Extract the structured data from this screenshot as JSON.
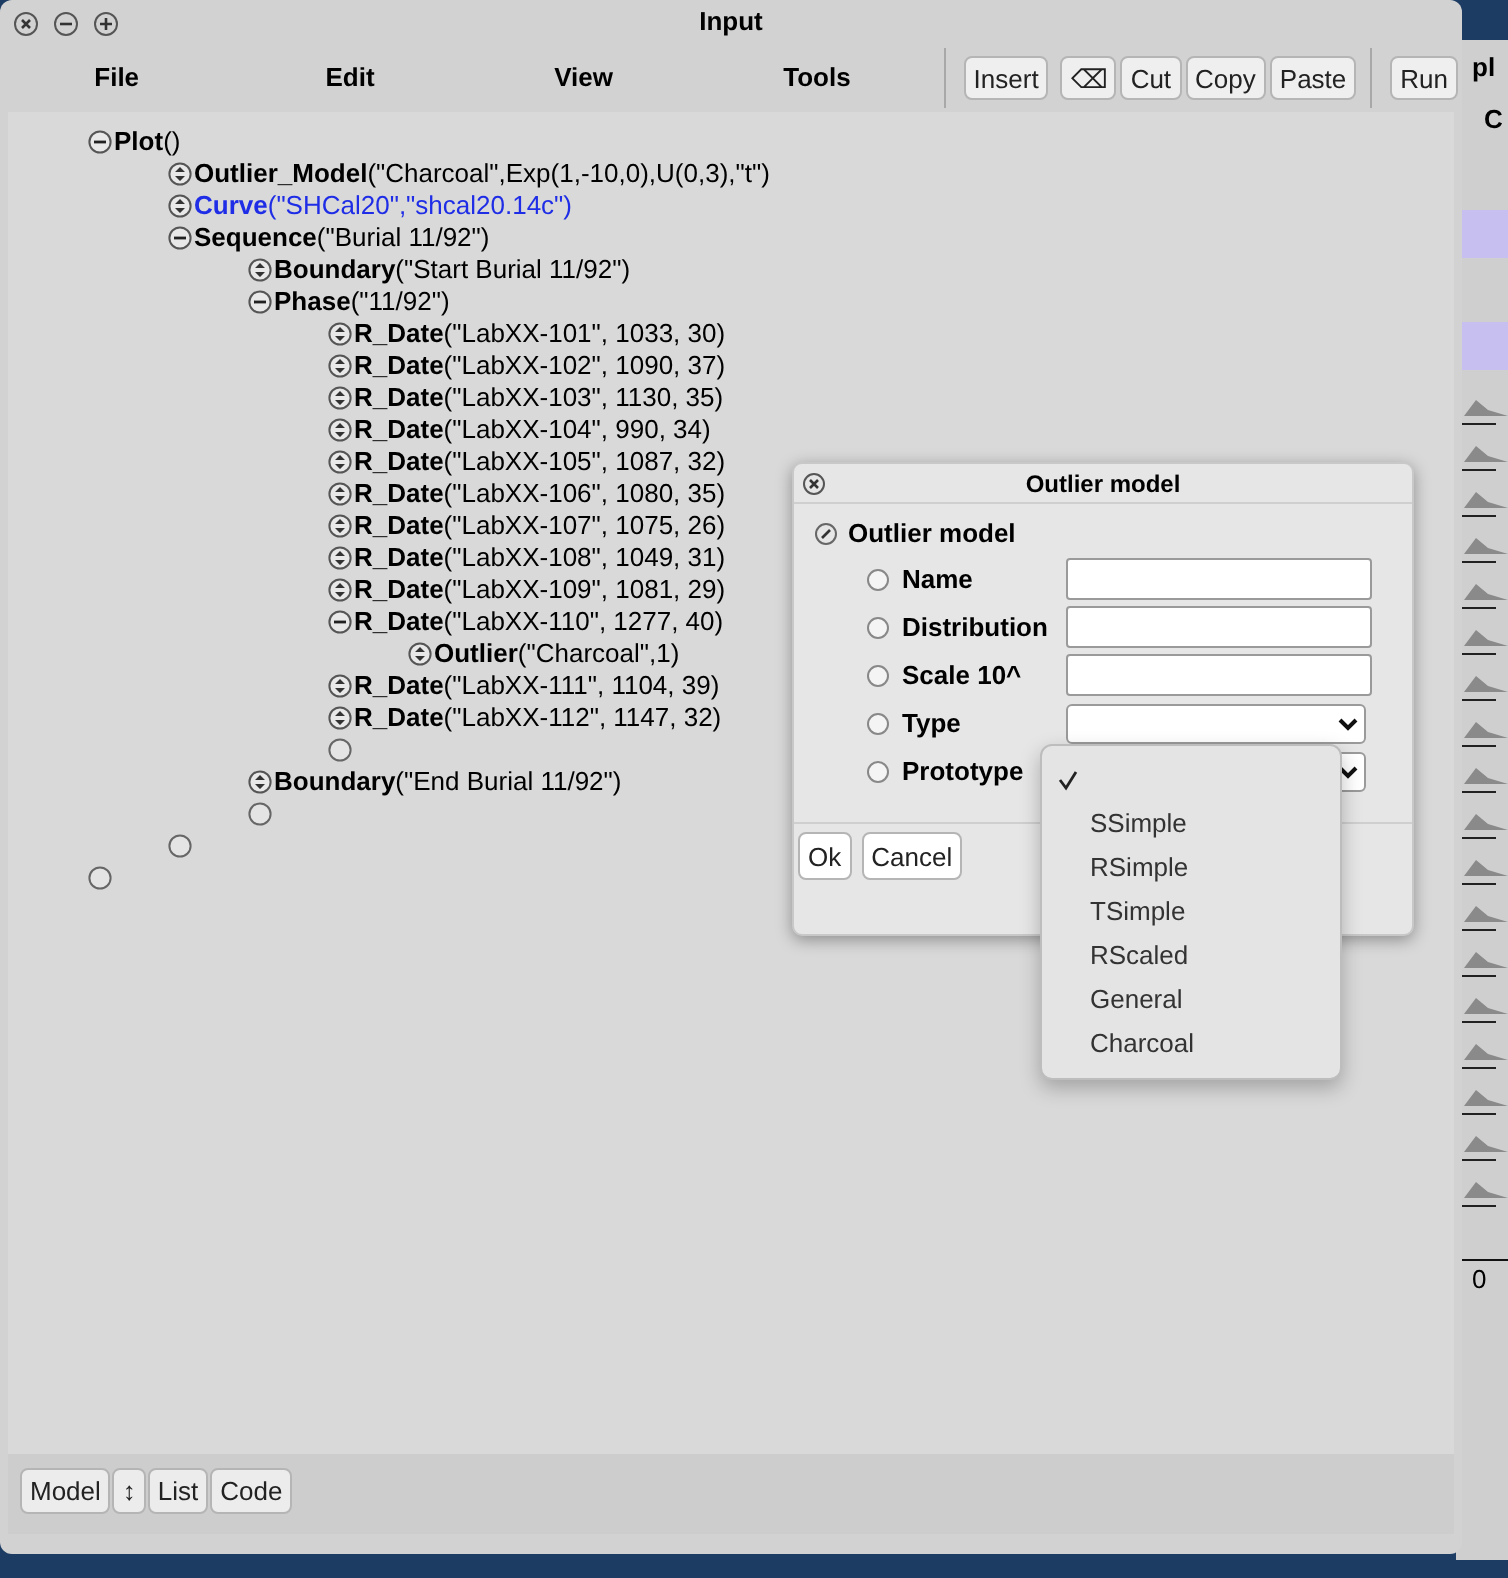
{
  "window": {
    "title": "Input"
  },
  "menu": [
    "File",
    "Edit",
    "View",
    "Tools"
  ],
  "toolbar": [
    [
      "Insert"
    ],
    [
      "⌫",
      "Cut",
      "Copy",
      "Paste"
    ],
    [
      "Run"
    ]
  ],
  "tree": [
    {
      "kind": "node",
      "expanded": true,
      "text": "**Plot**()",
      "highlighted": false,
      "children": [
        {
          "kind": "node",
          "expanded": false,
          "text": "**Outlier_Model**(\"Charcoal\",Exp(1,-10,0),U(0,3),\"t\")",
          "highlighted": false
        },
        {
          "kind": "node",
          "expanded": false,
          "text": "**Curve**(\"SHCal20\",\"shcal20.14c\")",
          "highlighted": true
        },
        {
          "kind": "node",
          "expanded": true,
          "text": "**Sequence**(\"Burial 11/92\")",
          "highlighted": false,
          "children": [
            {
              "kind": "node",
              "expanded": false,
              "text": "**Boundary**(\"Start Burial 11/92\")",
              "highlighted": false
            },
            {
              "kind": "node",
              "expanded": true,
              "text": "**Phase**(\"11/92\")",
              "highlighted": false,
              "children": [
                {
                  "kind": "node",
                  "expanded": false,
                  "text": "**R_Date**(\"LabXX-101\", 1033, 30)",
                  "highlighted": false
                },
                {
                  "kind": "node",
                  "expanded": false,
                  "text": "**R_Date**(\"LabXX-102\", 1090, 37)",
                  "highlighted": false
                },
                {
                  "kind": "node",
                  "expanded": false,
                  "text": "**R_Date**(\"LabXX-103\", 1130, 35)",
                  "highlighted": false
                },
                {
                  "kind": "node",
                  "expanded": false,
                  "text": "**R_Date**(\"LabXX-104\", 990, 34)",
                  "highlighted": false
                },
                {
                  "kind": "node",
                  "expanded": false,
                  "text": "**R_Date**(\"LabXX-105\", 1087, 32)",
                  "highlighted": false
                },
                {
                  "kind": "node",
                  "expanded": false,
                  "text": "**R_Date**(\"LabXX-106\", 1080, 35)",
                  "highlighted": false
                },
                {
                  "kind": "node",
                  "expanded": false,
                  "text": "**R_Date**(\"LabXX-107\", 1075, 26)",
                  "highlighted": false
                },
                {
                  "kind": "node",
                  "expanded": false,
                  "text": "**R_Date**(\"LabXX-108\", 1049, 31)",
                  "highlighted": false
                },
                {
                  "kind": "node",
                  "expanded": false,
                  "text": "**R_Date**(\"LabXX-109\", 1081, 29)",
                  "highlighted": false
                },
                {
                  "kind": "node",
                  "expanded": true,
                  "text": "**R_Date**(\"LabXX-110\", 1277, 40)",
                  "highlighted": false,
                  "children": [
                    {
                      "kind": "node",
                      "expanded": false,
                      "text": "**Outlier**(\"Charcoal\",1)",
                      "highlighted": false
                    }
                  ]
                },
                {
                  "kind": "node",
                  "expanded": false,
                  "text": "**R_Date**(\"LabXX-111\", 1104, 39)",
                  "highlighted": false
                },
                {
                  "kind": "node",
                  "expanded": false,
                  "text": "**R_Date**(\"LabXX-112\", 1147, 32)",
                  "highlighted": false
                },
                {
                  "kind": "placeholder"
                }
              ]
            },
            {
              "kind": "node",
              "expanded": false,
              "text": "**Boundary**(\"End Burial 11/92\")",
              "highlighted": false
            },
            {
              "kind": "placeholder"
            }
          ]
        },
        {
          "kind": "placeholder"
        }
      ]
    },
    {
      "kind": "placeholder"
    }
  ],
  "bottom_buttons": [
    "Model",
    "↕",
    "List",
    "Code"
  ],
  "dialog": {
    "title": "Outlier model",
    "heading": "Outlier model",
    "fields": [
      {
        "label": "Name",
        "kind": "input",
        "selected": false
      },
      {
        "label": "Distribution",
        "kind": "input",
        "selected": false
      },
      {
        "label": "Scale 10^",
        "kind": "input",
        "selected": false
      },
      {
        "label": "Type",
        "kind": "select",
        "selected": false
      },
      {
        "label": "Prototype",
        "kind": "select",
        "selected": false
      }
    ],
    "buttons": [
      "Ok",
      "Cancel"
    ],
    "dropdown": [
      {
        "selected": true
      },
      {
        "label": "SSimple",
        "selected": false
      },
      {
        "label": "RSimple",
        "selected": false
      },
      {
        "label": "TSimple",
        "selected": false
      },
      {
        "label": "RScaled",
        "selected": false
      },
      {
        "label": "General",
        "selected": false
      },
      {
        "label": "Charcoal",
        "selected": false
      }
    ]
  },
  "background_window": {
    "title": "pl",
    "header": "C",
    "axis_label": "0"
  }
}
